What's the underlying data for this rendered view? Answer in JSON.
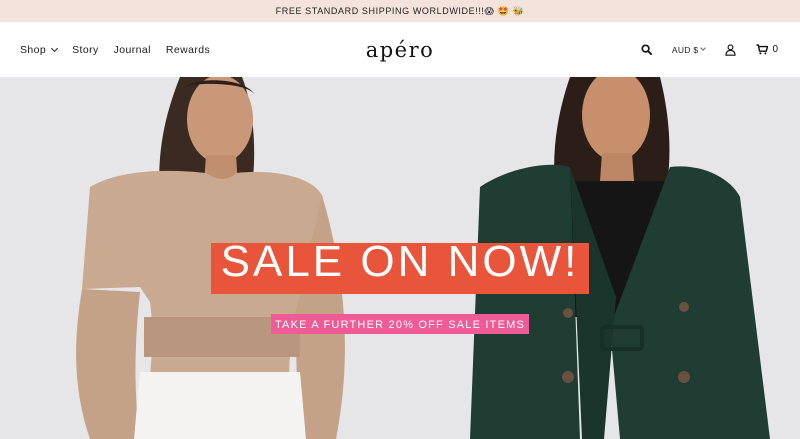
{
  "announcement": {
    "text": "FREE STANDARD SHIPPING WORLDWIDE!!!😱 🤩 🐝"
  },
  "nav": {
    "items": [
      {
        "label": "Shop"
      },
      {
        "label": "Story"
      },
      {
        "label": "Journal"
      },
      {
        "label": "Rewards"
      }
    ]
  },
  "logo": {
    "text": "apéro"
  },
  "utility": {
    "search_icon": "search-icon",
    "currency": "AUD $",
    "account_icon": "user-icon",
    "cart_icon": "cart-icon",
    "cart_count": "0"
  },
  "hero": {
    "title": "SALE ON NOW!",
    "subtitle": "TAKE A FURTHER 20% OFF SALE ITEMS"
  },
  "colors": {
    "announcement_bg": "#f3e3dc",
    "hero_bg": "#e6e6e8",
    "title_bg": "#e8553b",
    "subtitle_bg": "#ee5b96",
    "left_top": "#c9a98f",
    "right_blazer": "#1f3d33"
  }
}
